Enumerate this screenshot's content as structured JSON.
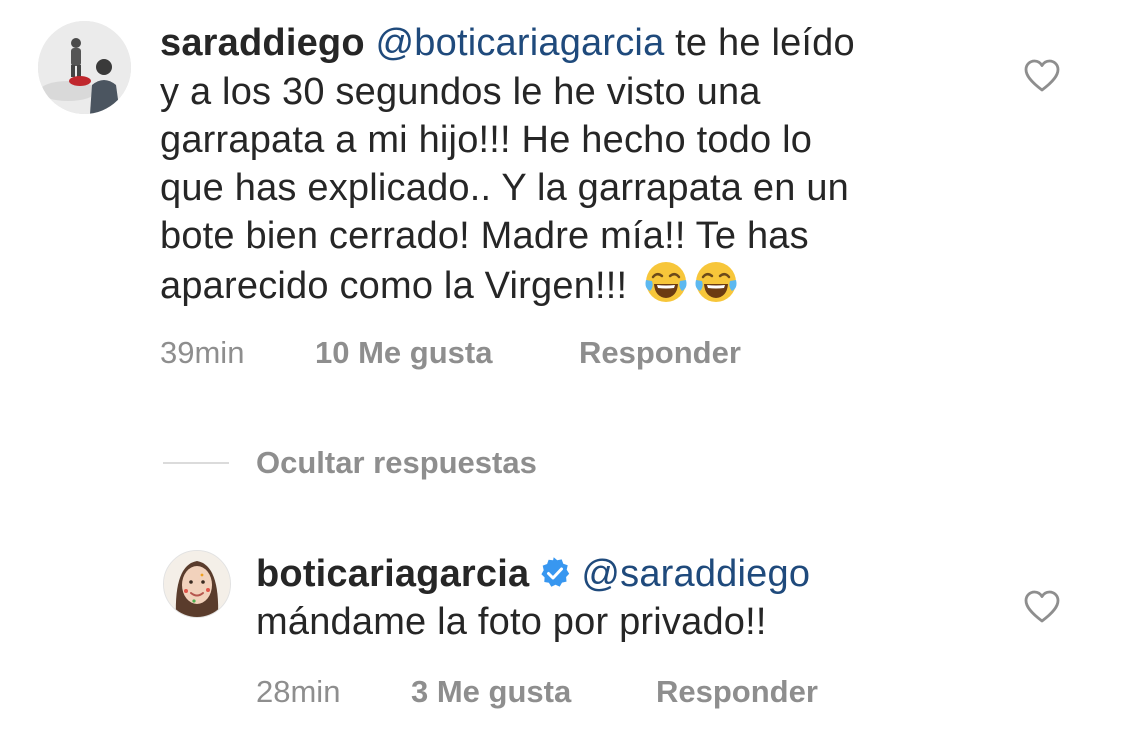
{
  "comment": {
    "username": "saraddiego",
    "mention": "@boticariagarcia",
    "lines": [
      " te he leído",
      "y a los 30 segundos le he visto una",
      "garrapata a mi hijo!!! He hecho todo lo",
      "que has explicado.. Y la garrapata en un",
      "bote bien cerrado! Madre mía!! Te has",
      "aparecido como la Virgen!!!"
    ],
    "emojis": [
      "face-with-tears-of-joy-icon",
      "face-with-tears-of-joy-icon"
    ],
    "time": "39min",
    "likes": "10 Me gusta",
    "reply": "Responder"
  },
  "hide_replies": "Ocultar respuestas",
  "reply_comment": {
    "username": "boticariagarcia",
    "verified": true,
    "mention": "@saraddiego",
    "text": "mándame la foto por privado!!",
    "time": "28min",
    "likes": "3 Me gusta",
    "reply": "Responder"
  },
  "colors": {
    "text": "#262626",
    "mention": "#1f4a7c",
    "meta": "#8e8e8e",
    "verified": "#3897f0",
    "divider": "#dbdbdb"
  }
}
